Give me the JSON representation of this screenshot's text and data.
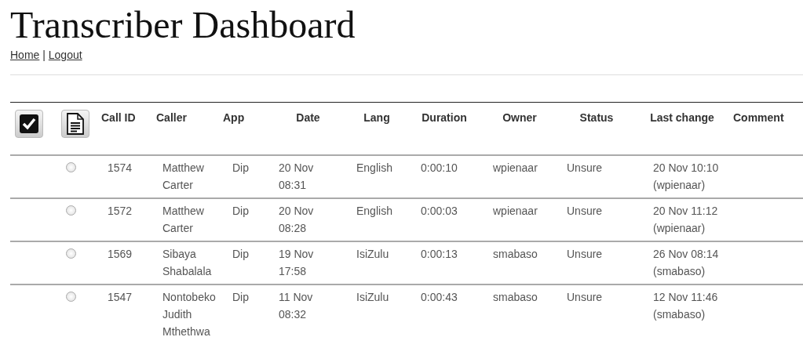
{
  "title": "Transcriber Dashboard",
  "nav": [
    "Home",
    "Logout"
  ],
  "nav_separator": "|",
  "table": {
    "columns": [
      "Call ID",
      "Caller",
      "App",
      "Date",
      "Lang",
      "Duration",
      "Owner",
      "Status",
      "Last change",
      "Comment"
    ],
    "rows": [
      {
        "selected": false,
        "cells": [
          "1574",
          "Matthew Carter",
          "Dip",
          "20 Nov 08:31",
          "English",
          "0:00:10",
          "wpienaar",
          "Unsure",
          "20 Nov 10:10 (wpienaar)",
          ""
        ]
      },
      {
        "selected": false,
        "cells": [
          "1572",
          "Matthew Carter",
          "Dip",
          "20 Nov 08:28",
          "English",
          "0:00:03",
          "wpienaar",
          "Unsure",
          "20 Nov 11:12 (wpienaar)",
          ""
        ]
      },
      {
        "selected": false,
        "cells": [
          "1569",
          "Sibaya Shabalala",
          "Dip",
          "19 Nov 17:58",
          "IsiZulu",
          "0:00:13",
          "smabaso",
          "Unsure",
          "26 Nov 08:14 (smabaso)",
          ""
        ]
      },
      {
        "selected": false,
        "cells": [
          "1547",
          "Nontobeko Judith Mthethwa",
          "Dip",
          "11 Nov 08:32",
          "IsiZulu",
          "0:00:43",
          "smabaso",
          "Unsure",
          "12 Nov 11:46 (smabaso)",
          ""
        ]
      }
    ]
  }
}
